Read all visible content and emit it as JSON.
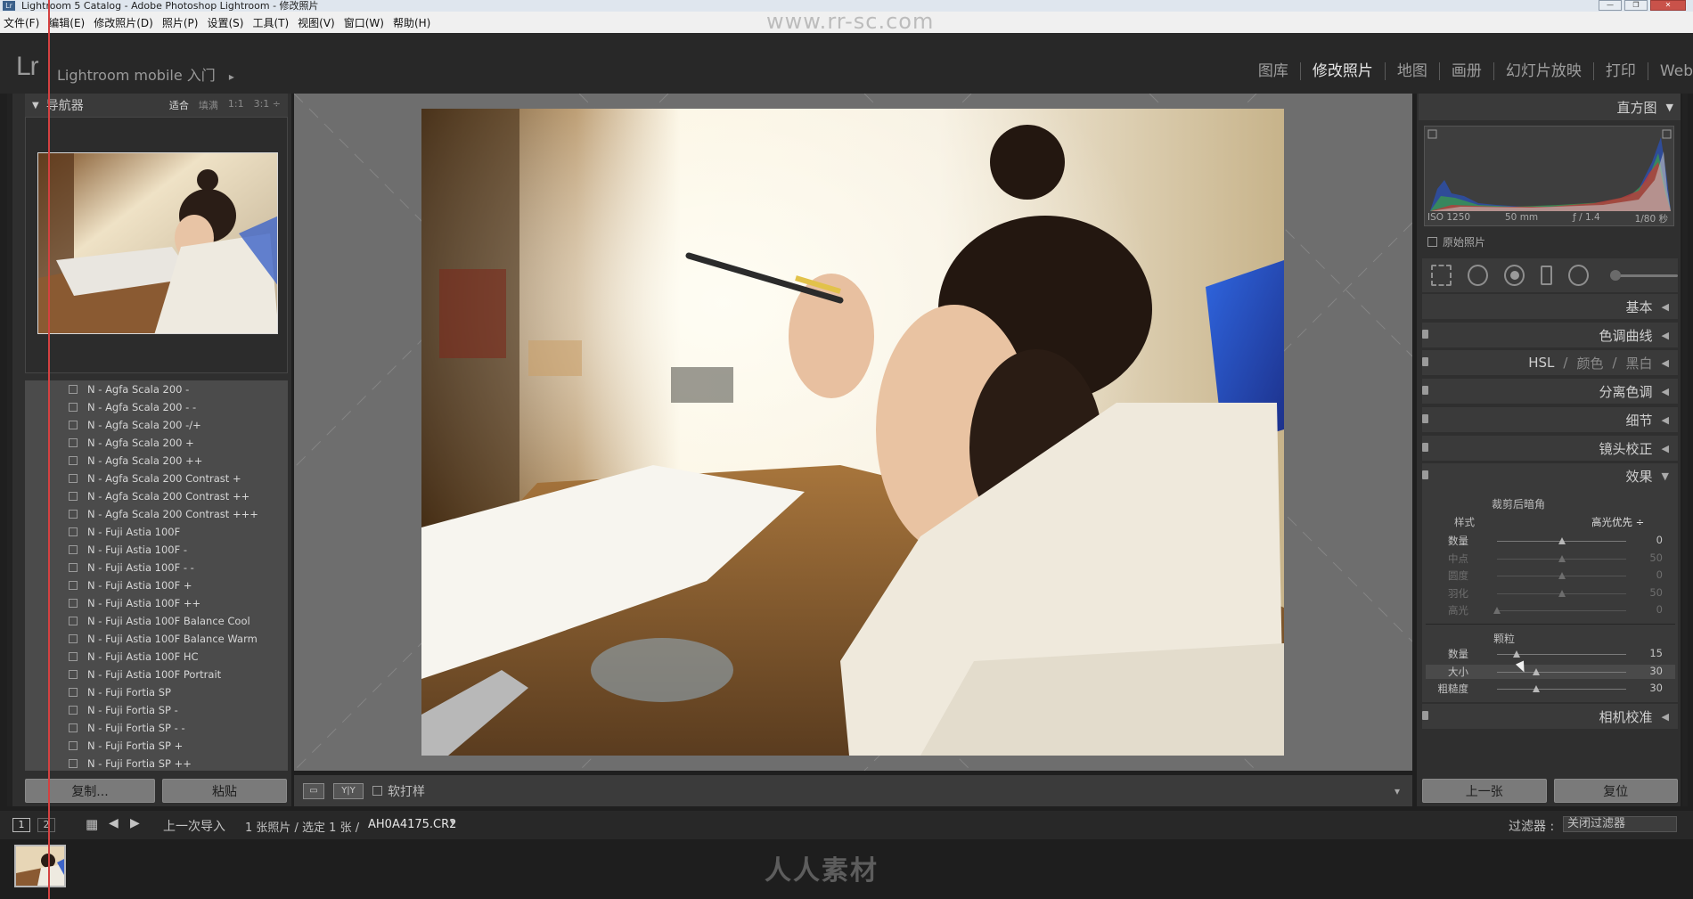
{
  "window": {
    "title": "Lightroom 5 Catalog - Adobe Photoshop Lightroom - 修改照片",
    "app_icon_text": "Lr"
  },
  "menu": [
    "文件(F)",
    "编辑(E)",
    "修改照片(D)",
    "照片(P)",
    "设置(S)",
    "工具(T)",
    "视图(V)",
    "窗口(W)",
    "帮助(H)"
  ],
  "identity": {
    "logo": "Lr",
    "mobile_label": "Lightroom mobile 入门",
    "mobile_arrow": "▸"
  },
  "modules": [
    {
      "label": "图库",
      "active": false
    },
    {
      "label": "修改照片",
      "active": true
    },
    {
      "label": "地图",
      "active": false
    },
    {
      "label": "画册",
      "active": false
    },
    {
      "label": "幻灯片放映",
      "active": false
    },
    {
      "label": "打印",
      "active": false
    },
    {
      "label": "Web",
      "active": false
    }
  ],
  "navigator": {
    "title": "导航器",
    "zoom": [
      {
        "label": "适合",
        "active": true
      },
      {
        "label": "填满",
        "active": false
      },
      {
        "label": "1:1",
        "active": false
      },
      {
        "label": "3:1 ÷",
        "active": false
      }
    ]
  },
  "presets": [
    "N - Agfa Scala 200 -",
    "N - Agfa Scala 200 - -",
    "N - Agfa Scala 200 -/+",
    "N - Agfa Scala 200 +",
    "N - Agfa Scala 200 ++",
    "N - Agfa Scala 200 Contrast +",
    "N - Agfa Scala 200 Contrast ++",
    "N - Agfa Scala 200 Contrast +++",
    "N - Fuji Astia 100F",
    "N - Fuji Astia 100F -",
    "N - Fuji Astia 100F - -",
    "N - Fuji Astia 100F +",
    "N - Fuji Astia 100F ++",
    "N - Fuji Astia 100F Balance Cool",
    "N - Fuji Astia 100F Balance Warm",
    "N - Fuji Astia 100F HC",
    "N - Fuji Astia 100F Portrait",
    "N - Fuji Fortia SP",
    "N - Fuji Fortia SP -",
    "N - Fuji Fortia SP - -",
    "N - Fuji Fortia SP +",
    "N - Fuji Fortia SP ++"
  ],
  "left_buttons": {
    "copy": "复制...",
    "paste": "粘贴"
  },
  "toolbar": {
    "view_icon": "▭",
    "compare_icon": "Y|Y",
    "soft_proof": "软打样",
    "caret": "▾"
  },
  "histogram": {
    "title": "直方图",
    "iso": "ISO 1250",
    "focal": "50 mm",
    "aperture": "ƒ / 1.4",
    "shutter": "1/80 秒",
    "original_photo": "原始照片"
  },
  "panels": {
    "basic": "基本",
    "tone_curve": "色调曲线",
    "hsl": "HSL",
    "color": "颜色",
    "bw": "黑白",
    "split": "分离色调",
    "detail": "细节",
    "lens": "镜头校正",
    "effects": "效果",
    "camera": "相机校准"
  },
  "effects": {
    "vignette_title": "裁剪后暗角",
    "style_label": "样式",
    "style_value": "高光优先 ÷",
    "vignette_sliders": [
      {
        "label": "数量",
        "value": "0",
        "pos": 0.5
      },
      {
        "label": "中点",
        "value": "50",
        "pos": 0.5
      },
      {
        "label": "圆度",
        "value": "0",
        "pos": 0.5
      },
      {
        "label": "羽化",
        "value": "50",
        "pos": 0.5
      },
      {
        "label": "高光",
        "value": "0",
        "pos": 0.0
      }
    ],
    "grain_title": "颗粒",
    "grain_sliders": [
      {
        "label": "数量",
        "value": "15",
        "pos": 0.15
      },
      {
        "label": "大小",
        "value": "30",
        "pos": 0.3
      },
      {
        "label": "粗糙度",
        "value": "30",
        "pos": 0.3
      }
    ]
  },
  "right_buttons": {
    "prev": "上一张",
    "reset": "复位"
  },
  "filmstrip": {
    "page1": "1",
    "page2": "2",
    "source": "上一次导入",
    "info": "1 张照片 / 选定 1 张 /",
    "filename": "AH0A4175.CR2",
    "filter_label": "过滤器 :",
    "filter_value": "关闭过滤器"
  },
  "watermarks": {
    "top": "www.rr-sc.com",
    "bottom": "人人素材"
  }
}
